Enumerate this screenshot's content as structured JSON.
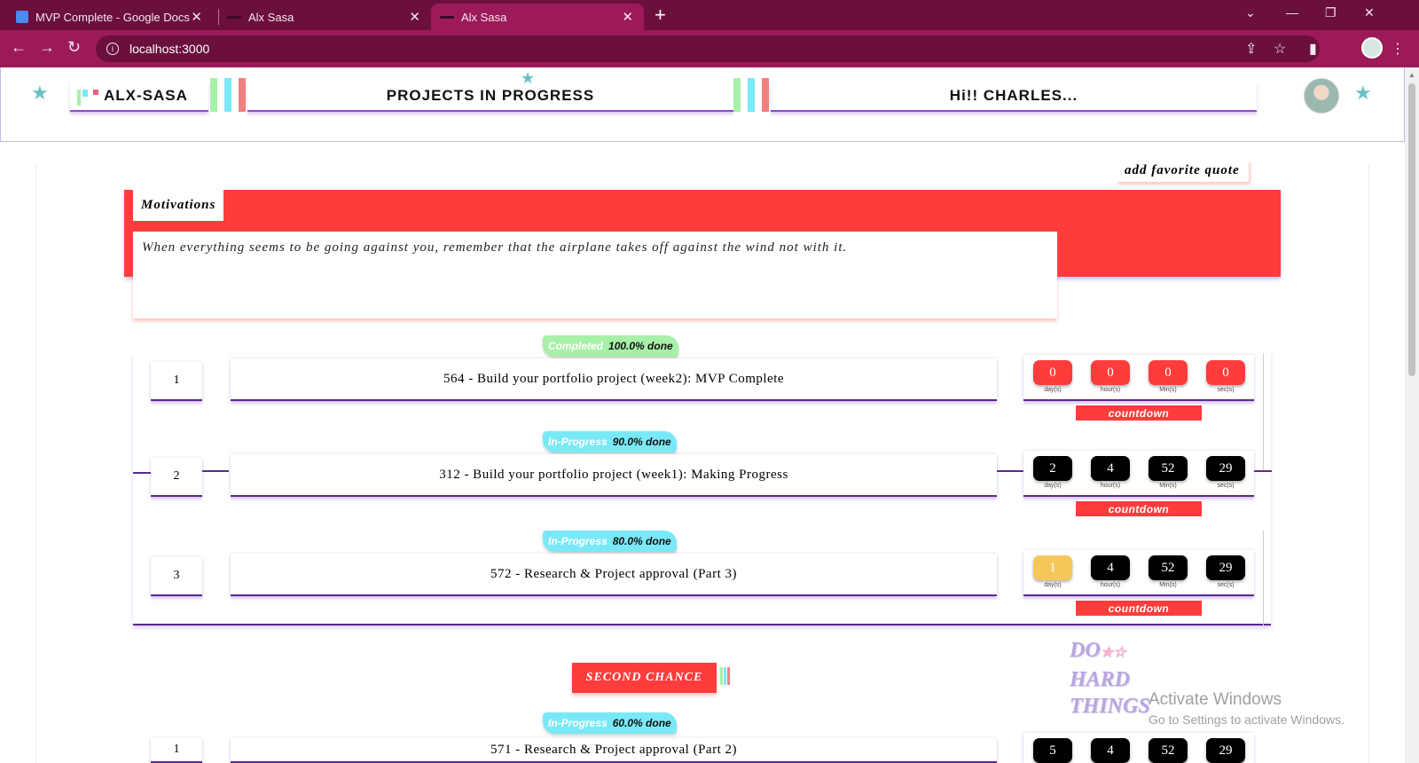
{
  "browser": {
    "tabs": [
      {
        "title": "MVP Complete - Google Docs"
      },
      {
        "title": "Alx Sasa"
      },
      {
        "title": "Alx Sasa"
      }
    ],
    "url": "localhost:3000"
  },
  "header": {
    "brand": "ALX-SASA",
    "section_title": "PROJECTS IN PROGRESS",
    "greeting": "Hi!! CHARLES..."
  },
  "quote_button": "add favorite quote",
  "motivations": {
    "title": "Motivations",
    "quote": "When everything seems to be going against you, remember that the airplane takes off against the wind not with it."
  },
  "timer_labels": {
    "days": "day(s)",
    "hours": "hour(s)",
    "mins": "Min(s)",
    "secs": "sec(s)"
  },
  "countdown_label": "countdown",
  "projects": [
    {
      "index": "1",
      "status": "Completed",
      "percent": "100.0% done",
      "title": "564  -  Build your portfolio project (week2): MVP Complete",
      "days": "0",
      "hours": "0",
      "mins": "0",
      "secs": "0"
    },
    {
      "index": "2",
      "status": "In-Progress",
      "percent": "90.0% done",
      "title": "312  -  Build your portfolio project (week1): Making Progress",
      "days": "2",
      "hours": "4",
      "mins": "52",
      "secs": "29"
    },
    {
      "index": "3",
      "status": "In-Progress",
      "percent": "80.0% done",
      "title": "572  -  Research & Project approval (Part 3)",
      "days": "1",
      "hours": "4",
      "mins": "52",
      "secs": "29"
    }
  ],
  "second_chance": {
    "label": "SECOND CHANCE",
    "projects": [
      {
        "index": "1",
        "status": "In-Progress",
        "percent": "60.0% done",
        "title": "571  -  Research & Project approval (Part 2)",
        "days": "5",
        "hours": "4",
        "mins": "52",
        "secs": "29"
      }
    ]
  },
  "motto": {
    "line1": "DO",
    "line2": "HARD",
    "line3": "THINGS"
  },
  "windows_watermark": {
    "line1": "Activate Windows",
    "line2": "Go to Settings to activate Windows."
  },
  "colors": {
    "accent_red": "#ff3c3c",
    "purple": "#5a2a8f",
    "completed_green": "#a7f0a7",
    "in_progress_cyan": "#7ae9f7",
    "chrome": "#9c1a59"
  }
}
